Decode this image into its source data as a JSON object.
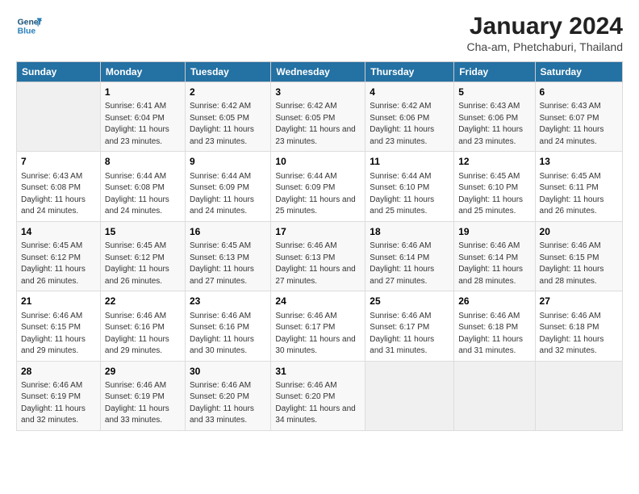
{
  "header": {
    "title": "January 2024",
    "subtitle": "Cha-am, Phetchaburi, Thailand"
  },
  "columns": [
    "Sunday",
    "Monday",
    "Tuesday",
    "Wednesday",
    "Thursday",
    "Friday",
    "Saturday"
  ],
  "weeks": [
    [
      {
        "day": "",
        "sunrise": "",
        "sunset": "",
        "daylight": ""
      },
      {
        "day": "1",
        "sunrise": "Sunrise: 6:41 AM",
        "sunset": "Sunset: 6:04 PM",
        "daylight": "Daylight: 11 hours and 23 minutes."
      },
      {
        "day": "2",
        "sunrise": "Sunrise: 6:42 AM",
        "sunset": "Sunset: 6:05 PM",
        "daylight": "Daylight: 11 hours and 23 minutes."
      },
      {
        "day": "3",
        "sunrise": "Sunrise: 6:42 AM",
        "sunset": "Sunset: 6:05 PM",
        "daylight": "Daylight: 11 hours and 23 minutes."
      },
      {
        "day": "4",
        "sunrise": "Sunrise: 6:42 AM",
        "sunset": "Sunset: 6:06 PM",
        "daylight": "Daylight: 11 hours and 23 minutes."
      },
      {
        "day": "5",
        "sunrise": "Sunrise: 6:43 AM",
        "sunset": "Sunset: 6:06 PM",
        "daylight": "Daylight: 11 hours and 23 minutes."
      },
      {
        "day": "6",
        "sunrise": "Sunrise: 6:43 AM",
        "sunset": "Sunset: 6:07 PM",
        "daylight": "Daylight: 11 hours and 24 minutes."
      }
    ],
    [
      {
        "day": "7",
        "sunrise": "Sunrise: 6:43 AM",
        "sunset": "Sunset: 6:08 PM",
        "daylight": "Daylight: 11 hours and 24 minutes."
      },
      {
        "day": "8",
        "sunrise": "Sunrise: 6:44 AM",
        "sunset": "Sunset: 6:08 PM",
        "daylight": "Daylight: 11 hours and 24 minutes."
      },
      {
        "day": "9",
        "sunrise": "Sunrise: 6:44 AM",
        "sunset": "Sunset: 6:09 PM",
        "daylight": "Daylight: 11 hours and 24 minutes."
      },
      {
        "day": "10",
        "sunrise": "Sunrise: 6:44 AM",
        "sunset": "Sunset: 6:09 PM",
        "daylight": "Daylight: 11 hours and 25 minutes."
      },
      {
        "day": "11",
        "sunrise": "Sunrise: 6:44 AM",
        "sunset": "Sunset: 6:10 PM",
        "daylight": "Daylight: 11 hours and 25 minutes."
      },
      {
        "day": "12",
        "sunrise": "Sunrise: 6:45 AM",
        "sunset": "Sunset: 6:10 PM",
        "daylight": "Daylight: 11 hours and 25 minutes."
      },
      {
        "day": "13",
        "sunrise": "Sunrise: 6:45 AM",
        "sunset": "Sunset: 6:11 PM",
        "daylight": "Daylight: 11 hours and 26 minutes."
      }
    ],
    [
      {
        "day": "14",
        "sunrise": "Sunrise: 6:45 AM",
        "sunset": "Sunset: 6:12 PM",
        "daylight": "Daylight: 11 hours and 26 minutes."
      },
      {
        "day": "15",
        "sunrise": "Sunrise: 6:45 AM",
        "sunset": "Sunset: 6:12 PM",
        "daylight": "Daylight: 11 hours and 26 minutes."
      },
      {
        "day": "16",
        "sunrise": "Sunrise: 6:45 AM",
        "sunset": "Sunset: 6:13 PM",
        "daylight": "Daylight: 11 hours and 27 minutes."
      },
      {
        "day": "17",
        "sunrise": "Sunrise: 6:46 AM",
        "sunset": "Sunset: 6:13 PM",
        "daylight": "Daylight: 11 hours and 27 minutes."
      },
      {
        "day": "18",
        "sunrise": "Sunrise: 6:46 AM",
        "sunset": "Sunset: 6:14 PM",
        "daylight": "Daylight: 11 hours and 27 minutes."
      },
      {
        "day": "19",
        "sunrise": "Sunrise: 6:46 AM",
        "sunset": "Sunset: 6:14 PM",
        "daylight": "Daylight: 11 hours and 28 minutes."
      },
      {
        "day": "20",
        "sunrise": "Sunrise: 6:46 AM",
        "sunset": "Sunset: 6:15 PM",
        "daylight": "Daylight: 11 hours and 28 minutes."
      }
    ],
    [
      {
        "day": "21",
        "sunrise": "Sunrise: 6:46 AM",
        "sunset": "Sunset: 6:15 PM",
        "daylight": "Daylight: 11 hours and 29 minutes."
      },
      {
        "day": "22",
        "sunrise": "Sunrise: 6:46 AM",
        "sunset": "Sunset: 6:16 PM",
        "daylight": "Daylight: 11 hours and 29 minutes."
      },
      {
        "day": "23",
        "sunrise": "Sunrise: 6:46 AM",
        "sunset": "Sunset: 6:16 PM",
        "daylight": "Daylight: 11 hours and 30 minutes."
      },
      {
        "day": "24",
        "sunrise": "Sunrise: 6:46 AM",
        "sunset": "Sunset: 6:17 PM",
        "daylight": "Daylight: 11 hours and 30 minutes."
      },
      {
        "day": "25",
        "sunrise": "Sunrise: 6:46 AM",
        "sunset": "Sunset: 6:17 PM",
        "daylight": "Daylight: 11 hours and 31 minutes."
      },
      {
        "day": "26",
        "sunrise": "Sunrise: 6:46 AM",
        "sunset": "Sunset: 6:18 PM",
        "daylight": "Daylight: 11 hours and 31 minutes."
      },
      {
        "day": "27",
        "sunrise": "Sunrise: 6:46 AM",
        "sunset": "Sunset: 6:18 PM",
        "daylight": "Daylight: 11 hours and 32 minutes."
      }
    ],
    [
      {
        "day": "28",
        "sunrise": "Sunrise: 6:46 AM",
        "sunset": "Sunset: 6:19 PM",
        "daylight": "Daylight: 11 hours and 32 minutes."
      },
      {
        "day": "29",
        "sunrise": "Sunrise: 6:46 AM",
        "sunset": "Sunset: 6:19 PM",
        "daylight": "Daylight: 11 hours and 33 minutes."
      },
      {
        "day": "30",
        "sunrise": "Sunrise: 6:46 AM",
        "sunset": "Sunset: 6:20 PM",
        "daylight": "Daylight: 11 hours and 33 minutes."
      },
      {
        "day": "31",
        "sunrise": "Sunrise: 6:46 AM",
        "sunset": "Sunset: 6:20 PM",
        "daylight": "Daylight: 11 hours and 34 minutes."
      },
      {
        "day": "",
        "sunrise": "",
        "sunset": "",
        "daylight": ""
      },
      {
        "day": "",
        "sunrise": "",
        "sunset": "",
        "daylight": ""
      },
      {
        "day": "",
        "sunrise": "",
        "sunset": "",
        "daylight": ""
      }
    ]
  ]
}
